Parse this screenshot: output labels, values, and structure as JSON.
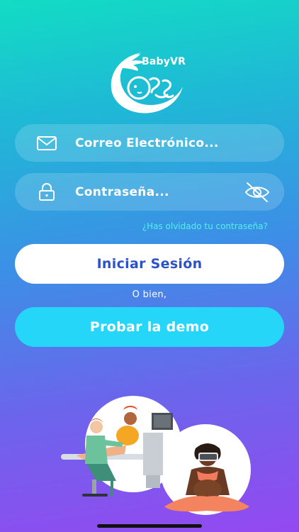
{
  "app": {
    "logo_text": "BabyVR"
  },
  "login": {
    "email_placeholder": "Correo Electrónico...",
    "password_placeholder": "Contraseña...",
    "forgot_password": "¿Has olvidado tu contraseña?",
    "login_button": "Iniciar Sesión",
    "or_text": "O bien,",
    "demo_button": "Probar la demo"
  },
  "icons": {
    "email": "mail-icon",
    "password": "lock-icon",
    "toggle_password": "eye-off-icon",
    "logo": "baby-logo-icon"
  },
  "colors": {
    "gradient_top": "#12dcc4",
    "gradient_bottom": "#9449f0",
    "login_button_bg": "#ffffff",
    "login_button_text": "#2b53c9",
    "demo_button_bg": "#26d6f8",
    "forgot_link": "#54f0ee"
  }
}
